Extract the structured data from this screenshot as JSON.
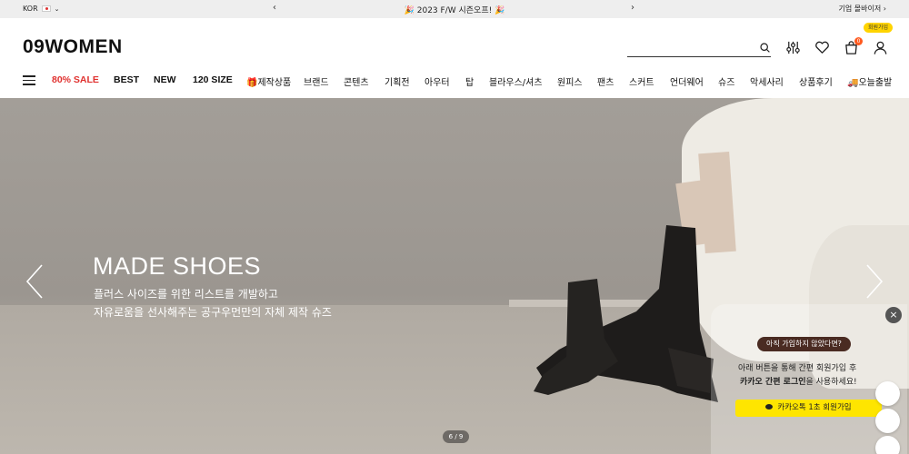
{
  "topbar": {
    "lang": "KOR",
    "promo": "🎉 2023 F/W 시즌오프! 🎉",
    "biz": "기업 몰바이저 ›"
  },
  "header": {
    "logo": "09WOMEN",
    "signup_tip": "회원가입",
    "search_placeholder": "",
    "cart_count": "0",
    "icons": [
      "search-icon",
      "filter-icon",
      "heart-icon",
      "cart-icon",
      "user-icon"
    ]
  },
  "nav": {
    "items": [
      "80% SALE",
      "BEST",
      "NEW",
      "120 SIZE",
      "🎁제작상품",
      "브랜드",
      "콘텐츠",
      "기획전",
      "아우터",
      "탑",
      "블라우스/셔츠",
      "원피스",
      "팬츠",
      "스커트",
      "언더웨어",
      "슈즈",
      "악세사리",
      "상품후기",
      "🚚오늘출발"
    ]
  },
  "hero": {
    "title": "MADE SHOES",
    "line1": "플러스 사이즈를 위한 리스트를 개발하고",
    "line2": "자유로움을 선사해주는 공구우먼만의 자체 제작 슈즈",
    "pager": "6 / 9"
  },
  "popup": {
    "tag": "아직 가입하지 않았다면?",
    "line1": "아래 버튼을 통해 간편 회원가입 후",
    "line2_bold": "카카오 간편 로그인",
    "line2_rest": "을 사용하세요!",
    "button": "카카오톡 1초 회원가입",
    "close": "×"
  },
  "colors": {
    "sale": "#e0312f",
    "kakao": "#fee500",
    "badge": "#ff5a1f"
  }
}
